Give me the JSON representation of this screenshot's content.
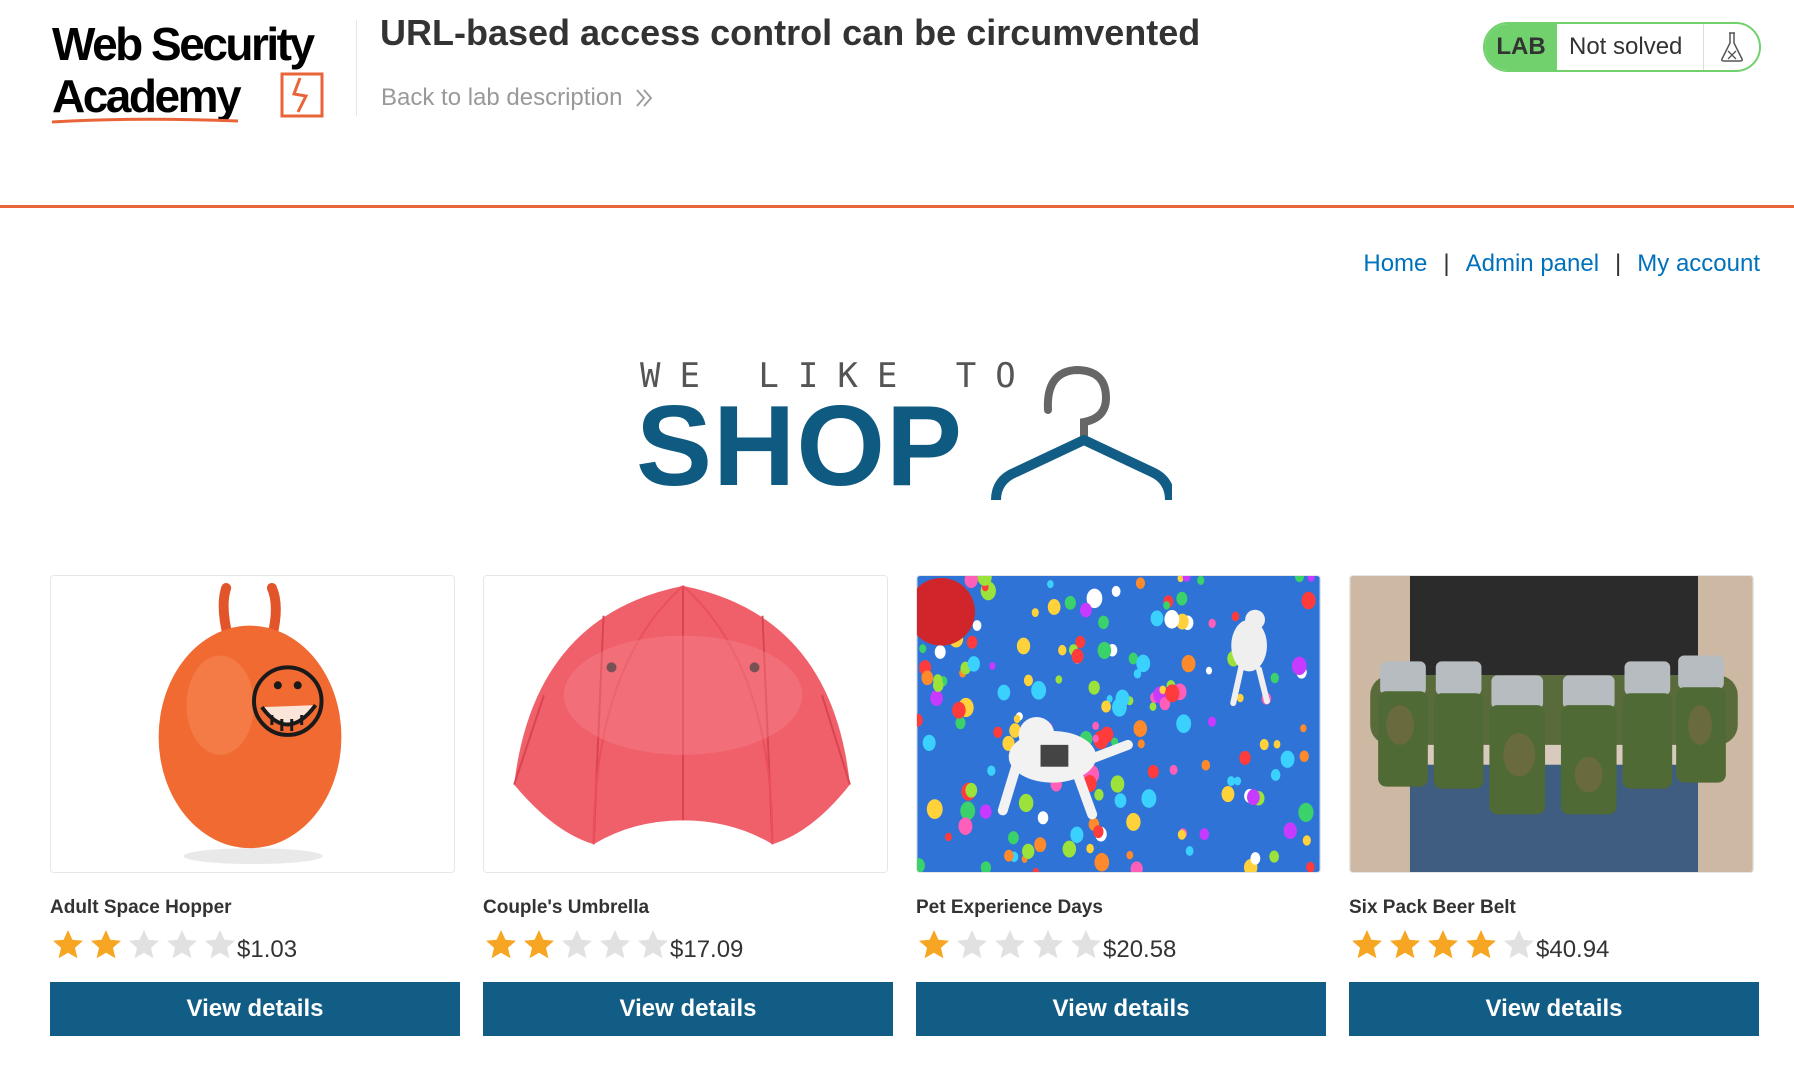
{
  "academy": {
    "logo_text_line1": "Web Security",
    "logo_text_line2": "Academy",
    "lab_title": "URL-based access control can be circumvented",
    "back_link": "Back to lab description",
    "lab_badge": "LAB",
    "lab_status": "Not solved",
    "accent_color": "#ea6439",
    "status_color": "#70d16d"
  },
  "nav": {
    "home": "Home",
    "admin_panel": "Admin panel",
    "my_account": "My account",
    "separator": "|"
  },
  "banner": {
    "small_text": "WE LIKE TO",
    "big_text": "SHOP",
    "icon": "hanger-icon"
  },
  "products": [
    {
      "name": "Adult Space Hopper",
      "rating": 2,
      "price": "$1.03",
      "button": "View details",
      "image": "space-hopper-image"
    },
    {
      "name": "Couple's Umbrella",
      "rating": 2,
      "price": "$17.09",
      "button": "View details",
      "image": "umbrella-image"
    },
    {
      "name": "Pet Experience Days",
      "rating": 1,
      "price": "$20.58",
      "button": "View details",
      "image": "balloon-dogs-image"
    },
    {
      "name": "Six Pack Beer Belt",
      "rating": 4,
      "price": "$40.94",
      "button": "View details",
      "image": "beer-belt-image"
    }
  ],
  "colors": {
    "button": "#125d85",
    "link": "#0071bc",
    "star_on": "#f6a623",
    "star_off": "#e1e1e1"
  }
}
